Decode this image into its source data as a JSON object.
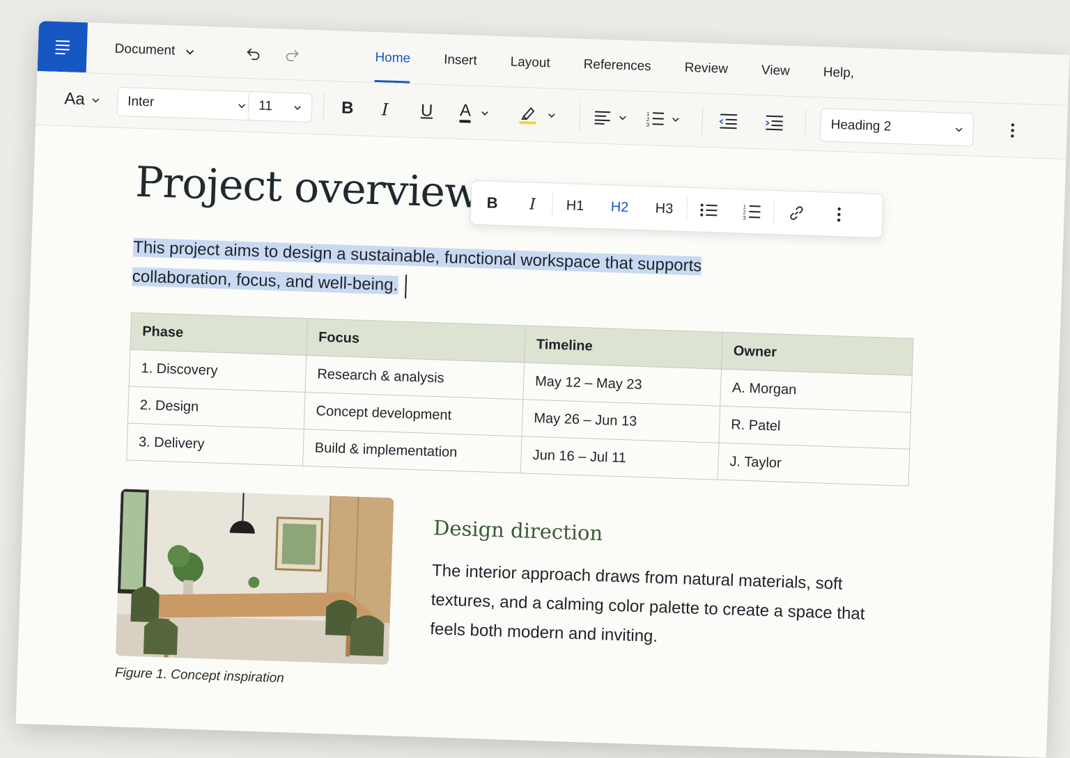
{
  "header": {
    "document_label": "Document",
    "tabs": [
      "Home",
      "Insert",
      "Layout",
      "References",
      "Review",
      "View",
      "Help,"
    ],
    "active_tab": "Home"
  },
  "ribbon": {
    "styles_label": "Aa",
    "font_family": "Inter",
    "font_size": "11",
    "bold_label": "B",
    "italic_label": "I",
    "underline_label": "U",
    "font_color_label": "A",
    "style_value": "Heading 2"
  },
  "floating_toolbar": {
    "bold": "B",
    "italic": "I",
    "h1": "H1",
    "h2": "H2",
    "h3": "H3"
  },
  "document": {
    "title": "Project overview",
    "intro_line1": "This project aims to design a sustainable, functional workspace that supports",
    "intro_line2": "collaboration, focus, and well-being.",
    "table": {
      "headers": [
        "Phase",
        "Focus",
        "Timeline",
        "Owner"
      ],
      "rows": [
        [
          "1. Discovery",
          "Research & analysis",
          "May 12 – May 23",
          "A. Morgan"
        ],
        [
          "2. Design",
          "Concept development",
          "May 26 – Jun 13",
          "R. Patel"
        ],
        [
          "3. Delivery",
          "Build & implementation",
          "Jun 16 – Jul 11",
          "J. Taylor"
        ]
      ]
    },
    "figure_caption": "Figure 1. Concept inspiration",
    "section_heading": "Design direction",
    "section_body": "The interior approach draws from natural materials, soft textures, and a calming color palette to create a space that feels both modern and inviting."
  },
  "colors": {
    "accent": "#1757c2",
    "selection": "#c9d9f3",
    "table_header": "#dde3d3",
    "section_heading": "#3a5a34",
    "highlight_marker": "#f2d33a"
  }
}
